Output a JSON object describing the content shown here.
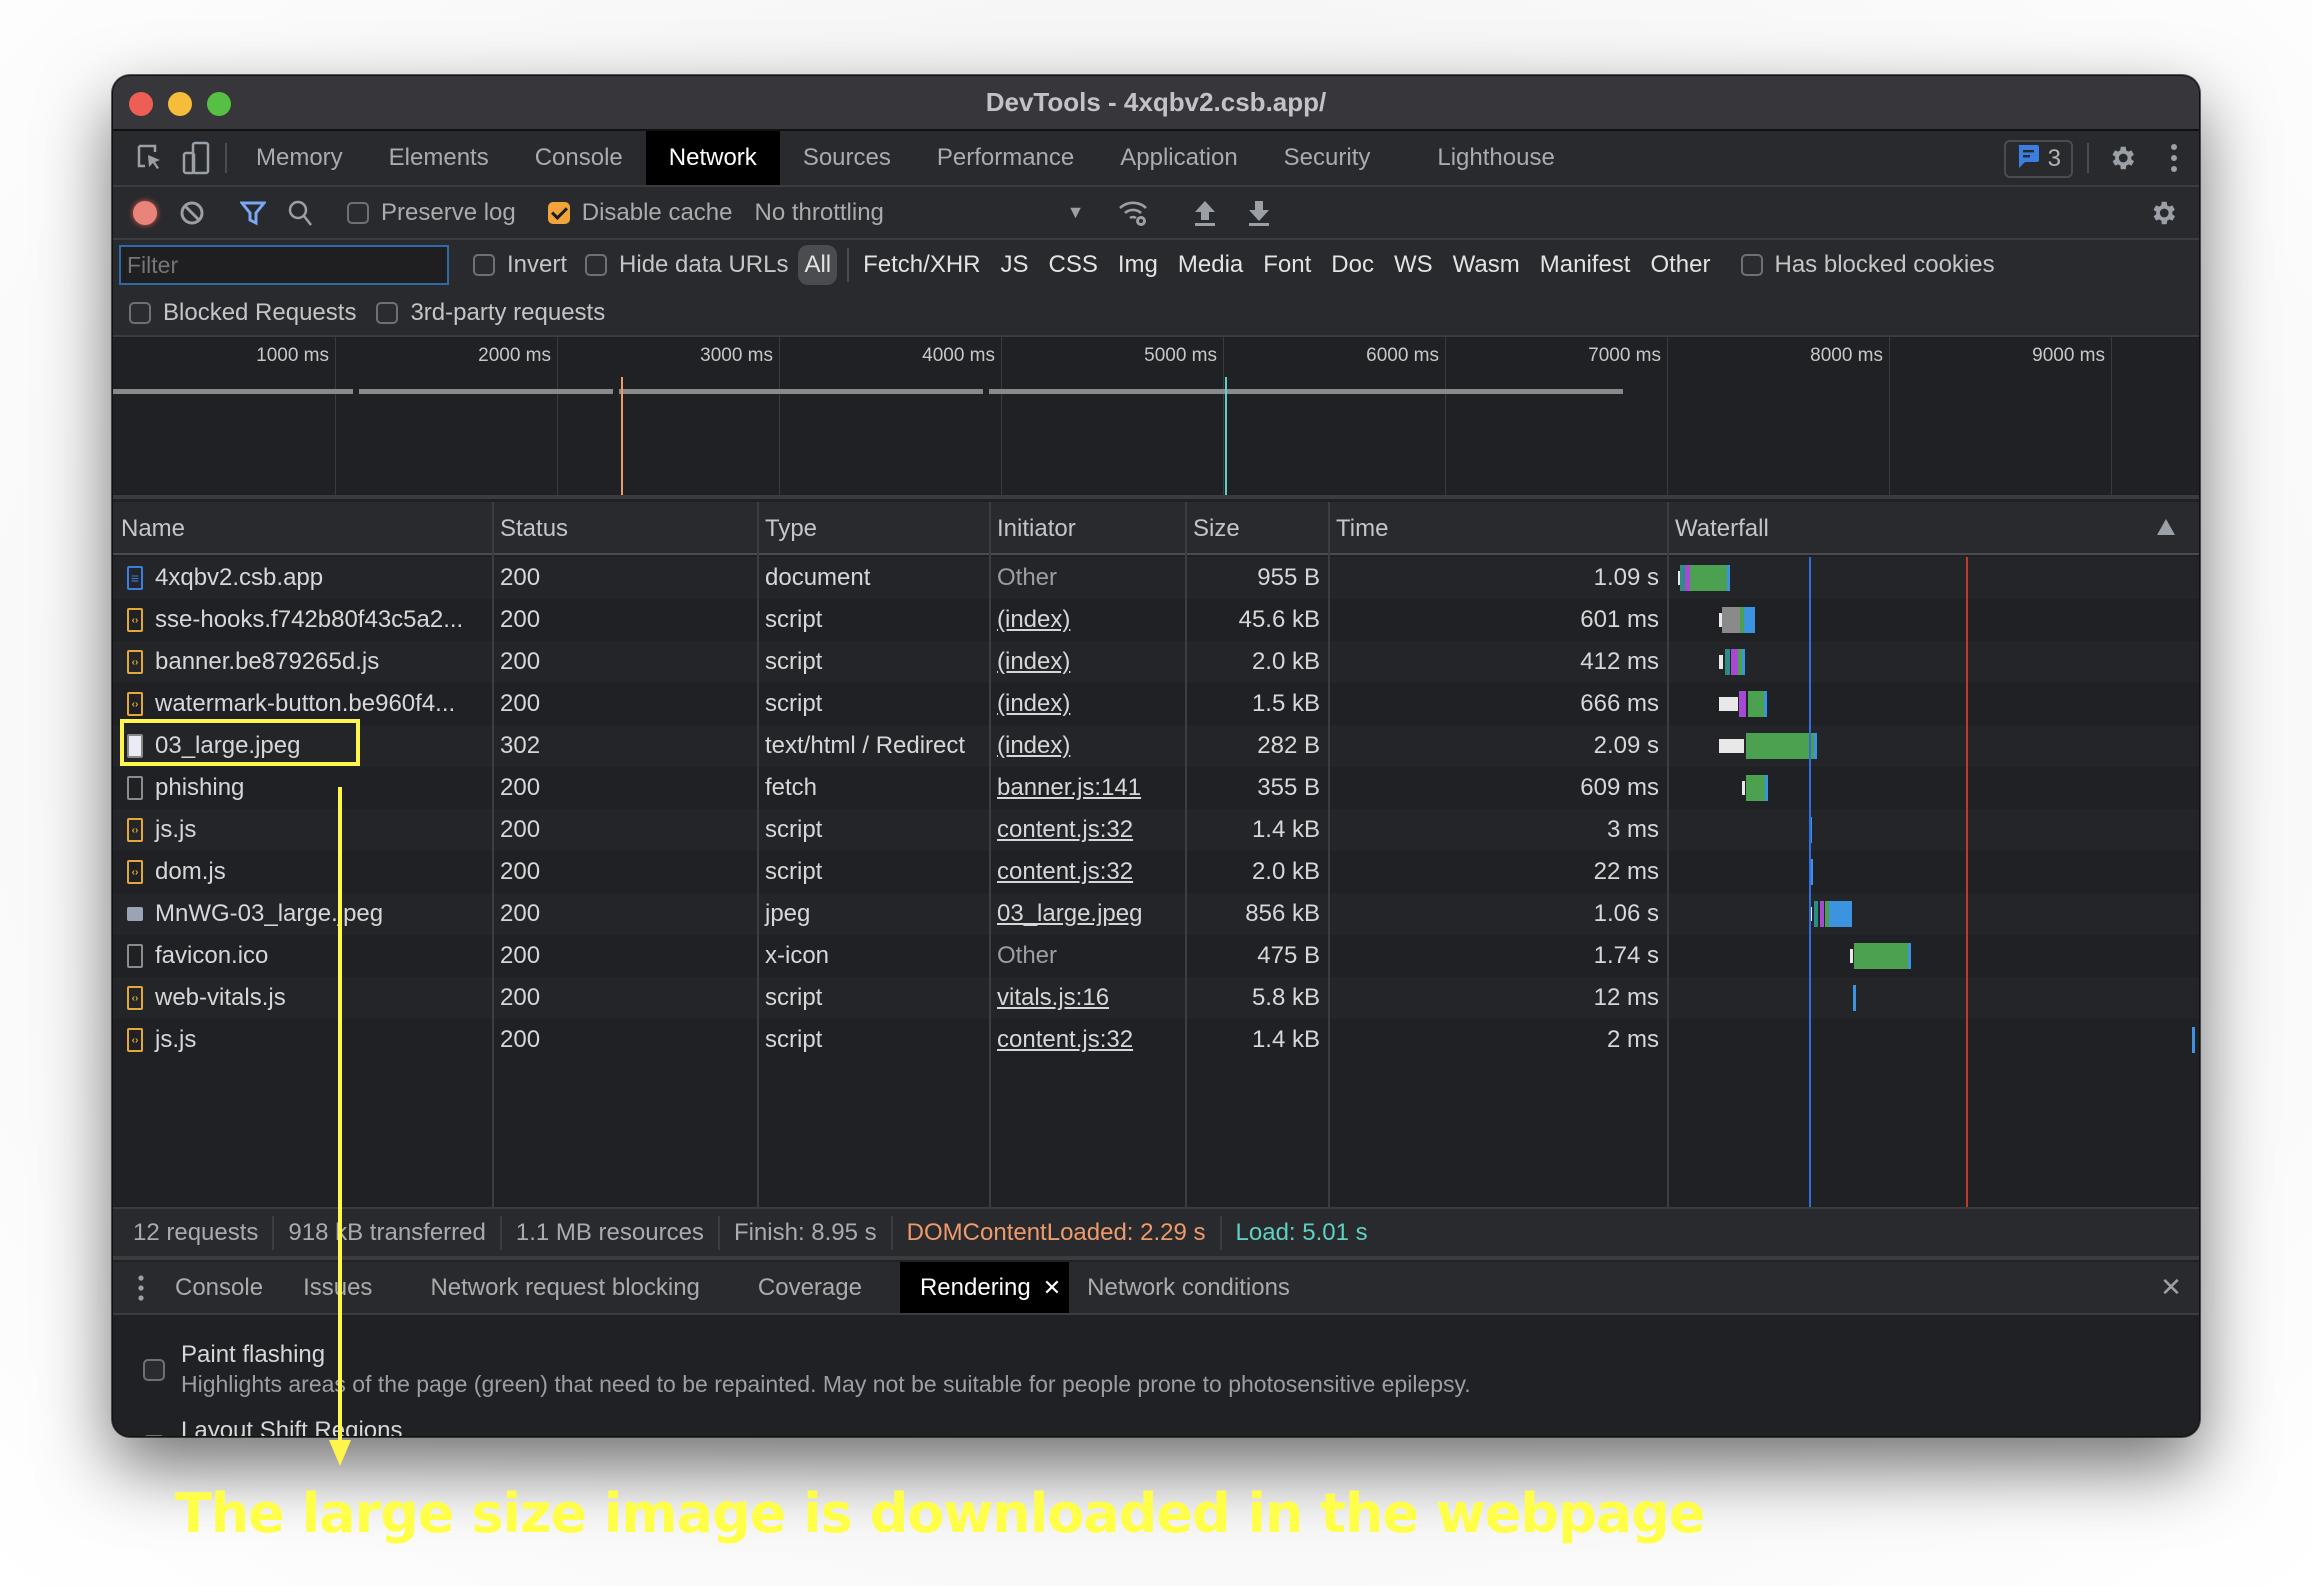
{
  "window": {
    "title": "DevTools - 4xqbv2.csb.app/"
  },
  "main_tabs": [
    {
      "label": "Memory",
      "active": false
    },
    {
      "label": "Elements",
      "active": false
    },
    {
      "label": "Console",
      "active": false
    },
    {
      "label": "Network",
      "active": true
    },
    {
      "label": "Sources",
      "active": false
    },
    {
      "label": "Performance",
      "active": false
    },
    {
      "label": "Application",
      "active": false
    },
    {
      "label": "Security",
      "active": false
    },
    {
      "label": "Lighthouse",
      "active": false
    }
  ],
  "issues_badge": {
    "count": "3",
    "icon": "message-icon"
  },
  "toolbar": {
    "preserve_log": {
      "label": "Preserve log",
      "checked": false
    },
    "disable_cache": {
      "label": "Disable cache",
      "checked": true
    },
    "throttling": "No throttling"
  },
  "filter": {
    "placeholder": "Filter",
    "value": "",
    "invert": {
      "label": "Invert",
      "checked": false
    },
    "hide_data_urls": {
      "label": "Hide data URLs",
      "checked": false
    },
    "types": [
      "All",
      "Fetch/XHR",
      "JS",
      "CSS",
      "Img",
      "Media",
      "Font",
      "Doc",
      "WS",
      "Wasm",
      "Manifest",
      "Other"
    ],
    "active_type": "All",
    "has_blocked_cookies": {
      "label": "Has blocked cookies",
      "checked": false
    },
    "blocked_requests": {
      "label": "Blocked Requests",
      "checked": false
    },
    "third_party": {
      "label": "3rd-party requests",
      "checked": false
    }
  },
  "overview": {
    "ticks": [
      "1000 ms",
      "2000 ms",
      "3000 ms",
      "4000 ms",
      "5000 ms",
      "6000 ms",
      "7000 ms",
      "8000 ms",
      "9000 ms"
    ],
    "dom_content_loaded_ms": 2290,
    "load_ms": 5010
  },
  "columns": [
    "Name",
    "Status",
    "Type",
    "Initiator",
    "Size",
    "Time",
    "Waterfall"
  ],
  "rows": [
    {
      "name": "4xqbv2.csb.app",
      "icon": "document",
      "status": "200",
      "type": "document",
      "initiator": "Other",
      "initiator_link": false,
      "size": "955 B",
      "time": "1.09 s",
      "wf": [
        {
          "s": 0.02,
          "e": 0.06,
          "c": "#e8e8e8"
        },
        {
          "s": 0.06,
          "e": 0.14,
          "c": "#2d8d84"
        },
        {
          "s": 0.14,
          "e": 0.22,
          "c": "#a64ad4"
        },
        {
          "s": 0.22,
          "e": 0.86,
          "c": "#4ba14f"
        },
        {
          "s": 0.86,
          "e": 0.9,
          "c": "#3c94e0"
        }
      ]
    },
    {
      "name": "sse-hooks.f742b80f43c5a2...",
      "icon": "script",
      "status": "200",
      "type": "script",
      "initiator": "(index)",
      "initiator_link": true,
      "size": "45.6 kB",
      "time": "601 ms",
      "wf": [
        {
          "s": 0.73,
          "e": 0.78,
          "c": "#e8e8e8"
        },
        {
          "s": 0.78,
          "e": 1.1,
          "c": "#8a8a8a"
        },
        {
          "s": 1.1,
          "e": 1.16,
          "c": "#4ba14f"
        },
        {
          "s": 1.16,
          "e": 1.35,
          "c": "#3c94e0"
        }
      ]
    },
    {
      "name": "banner.be879265d.js",
      "icon": "script",
      "status": "200",
      "type": "script",
      "initiator": "(index)",
      "initiator_link": true,
      "size": "2.0 kB",
      "time": "412 ms",
      "wf": [
        {
          "s": 0.73,
          "e": 0.79,
          "c": "#e8e8e8"
        },
        {
          "s": 0.83,
          "e": 0.92,
          "c": "#2d8d84"
        },
        {
          "s": 0.94,
          "e": 1.06,
          "c": "#a64ad4"
        },
        {
          "s": 1.06,
          "e": 1.12,
          "c": "#4ba14f"
        },
        {
          "s": 1.12,
          "e": 1.17,
          "c": "#3c94e0"
        }
      ]
    },
    {
      "name": "watermark-button.be960f4...",
      "icon": "script",
      "status": "200",
      "type": "script",
      "initiator": "(index)",
      "initiator_link": true,
      "size": "1.5 kB",
      "time": "666 ms",
      "wf": [
        {
          "s": 0.73,
          "e": 1.06,
          "c": "#e8e8e8"
        },
        {
          "s": 1.08,
          "e": 1.2,
          "c": "#a64ad4"
        },
        {
          "s": 1.23,
          "e": 1.5,
          "c": "#4ba14f"
        },
        {
          "s": 1.5,
          "e": 1.55,
          "c": "#3c94e0"
        }
      ]
    },
    {
      "name": "03_large.jpeg",
      "icon": "image-white",
      "status": "302",
      "type": "text/html / Redirect",
      "initiator": "(index)",
      "initiator_link": true,
      "size": "282 B",
      "time": "2.09 s",
      "wf": [
        {
          "s": 0.73,
          "e": 1.17,
          "c": "#e8e8e8"
        },
        {
          "s": 1.19,
          "e": 2.38,
          "c": "#4ba14f"
        },
        {
          "s": 2.38,
          "e": 2.43,
          "c": "#3c94e0"
        }
      ]
    },
    {
      "name": "phishing",
      "icon": "blank",
      "status": "200",
      "type": "fetch",
      "initiator": "banner.js:141",
      "initiator_link": true,
      "size": "355 B",
      "time": "609 ms",
      "wf": [
        {
          "s": 1.12,
          "e": 1.16,
          "c": "#e8e8e8"
        },
        {
          "s": 1.19,
          "e": 1.52,
          "c": "#4ba14f"
        },
        {
          "s": 1.52,
          "e": 1.56,
          "c": "#3c94e0"
        }
      ]
    },
    {
      "name": "js.js",
      "icon": "script",
      "status": "200",
      "type": "script",
      "initiator": "content.js:32",
      "initiator_link": true,
      "size": "1.4 kB",
      "time": "3 ms",
      "wf": [
        {
          "s": 2.28,
          "e": 2.33,
          "c": "#3c94e0"
        }
      ]
    },
    {
      "name": "dom.js",
      "icon": "script",
      "status": "200",
      "type": "script",
      "initiator": "content.js:32",
      "initiator_link": true,
      "size": "2.0 kB",
      "time": "22 ms",
      "wf": [
        {
          "s": 2.3,
          "e": 2.35,
          "c": "#3c94e0"
        }
      ]
    },
    {
      "name": "MnWG-03_large.jpeg",
      "icon": "image",
      "status": "200",
      "type": "jpeg",
      "initiator": "03_large.jpeg",
      "initiator_link": true,
      "size": "856 kB",
      "time": "1.06 s",
      "wf": [
        {
          "s": 2.28,
          "e": 2.34,
          "c": "#e8e8e8"
        },
        {
          "s": 2.37,
          "e": 2.45,
          "c": "#2d8d84"
        },
        {
          "s": 2.47,
          "e": 2.55,
          "c": "#a64ad4"
        },
        {
          "s": 2.57,
          "e": 2.63,
          "c": "#4ba14f"
        },
        {
          "s": 2.63,
          "e": 3.04,
          "c": "#3c94e0"
        }
      ]
    },
    {
      "name": "favicon.ico",
      "icon": "blank",
      "status": "200",
      "type": "x-icon",
      "initiator": "Other",
      "initiator_link": false,
      "size": "475 B",
      "time": "1.74 s",
      "wf": [
        {
          "s": 3.0,
          "e": 3.04,
          "c": "#e8e8e8"
        },
        {
          "s": 3.07,
          "e": 4.01,
          "c": "#4ba14f"
        },
        {
          "s": 4.01,
          "e": 4.05,
          "c": "#3c94e0"
        }
      ]
    },
    {
      "name": "web-vitals.js",
      "icon": "script",
      "status": "200",
      "type": "script",
      "initiator": "vitals.js:16",
      "initiator_link": true,
      "size": "5.8 kB",
      "time": "12 ms",
      "wf": [
        {
          "s": 3.05,
          "e": 3.09,
          "c": "#3c94e0"
        }
      ]
    },
    {
      "name": "js.js",
      "icon": "script",
      "status": "200",
      "type": "script",
      "initiator": "content.js:32",
      "initiator_link": true,
      "size": "1.4 kB",
      "time": "2 ms",
      "wf": [
        {
          "s": 8.93,
          "e": 8.95,
          "c": "#3c94e0"
        }
      ]
    }
  ],
  "status_bar": {
    "requests": "12 requests",
    "transferred": "918 kB transferred",
    "resources": "1.1 MB resources",
    "finish": "Finish: 8.95 s",
    "dom_content_loaded": "DOMContentLoaded: 2.29 s",
    "load": "Load: 5.01 s"
  },
  "drawer": {
    "tabs": [
      {
        "label": "Console",
        "active": false
      },
      {
        "label": "Issues",
        "active": false
      },
      {
        "label": "Network request blocking",
        "active": false
      },
      {
        "label": "Coverage",
        "active": false
      },
      {
        "label": "Rendering",
        "active": true,
        "closable": true
      },
      {
        "label": "Network conditions",
        "active": false
      }
    ],
    "options": [
      {
        "title": "Paint flashing",
        "description": "Highlights areas of the page (green) that need to be repainted. May not be suitable for people prone to photosensitive epilepsy.",
        "checked": false
      },
      {
        "title": "Layout Shift Regions",
        "description": "",
        "checked": false
      }
    ]
  },
  "annotation": {
    "caption": "The large size image is downloaded in the webpage",
    "highlight_target": "03_large.jpeg",
    "color": "#fff64d"
  }
}
